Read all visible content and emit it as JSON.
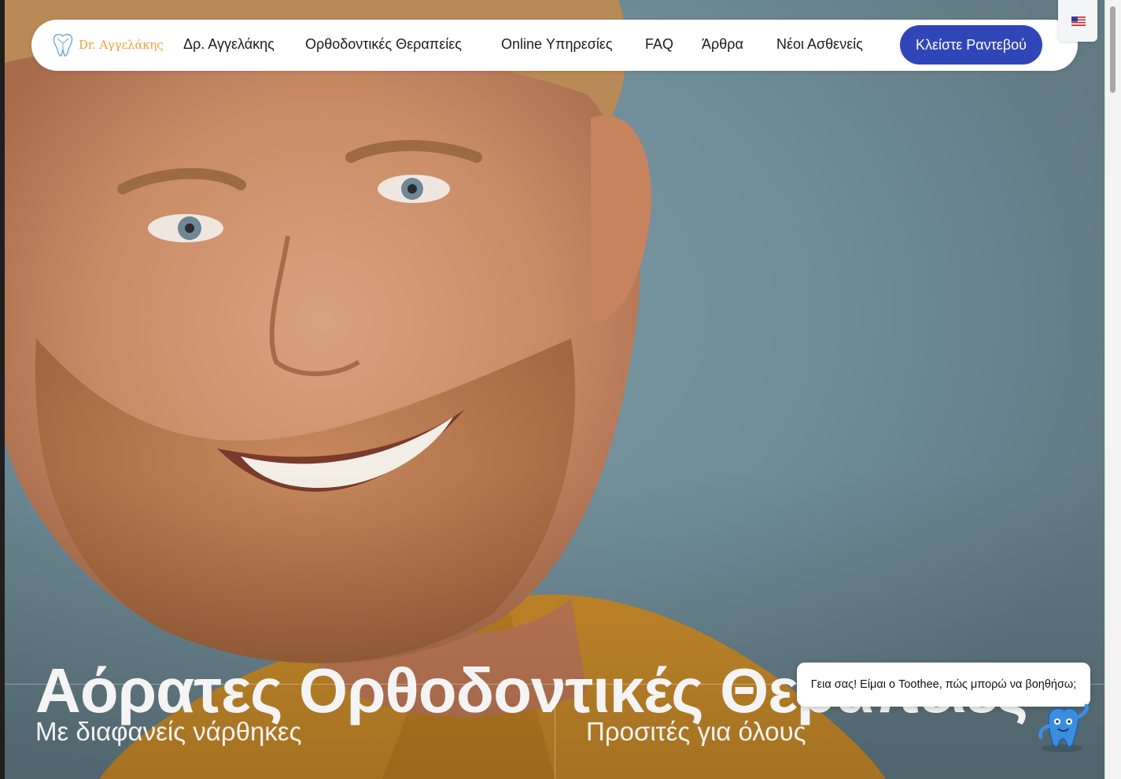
{
  "header": {
    "logo_text": "Dr. Αγγελάκης",
    "nav": [
      "Δρ. Αγγελάκης",
      "Ορθοδοντικές Θεραπείες",
      "Online Υπηρεσίες",
      "FAQ",
      "Άρθρα",
      "Νέοι Ασθενείς"
    ],
    "cta_label": "Κλείστε Ραντεβού"
  },
  "hero": {
    "headline": "Αόρατες Ορθοδοντικές Θεραπείες",
    "features": [
      "Με διαφανείς νάρθηκες",
      "Προσιτές για όλους"
    ]
  },
  "chat": {
    "greeting": "Γεια σας! Είμαι ο Toothee, πώς μπορώ να βοηθήσω;"
  },
  "colors": {
    "accent_blue": "#3046b8",
    "logo_orange": "#e8a43e",
    "background_teal": "#6f8c97"
  },
  "icons": {
    "logo": "tooth-logo-icon",
    "language": "us-flag-icon",
    "chat_mascot": "toothee-mascot-icon"
  }
}
